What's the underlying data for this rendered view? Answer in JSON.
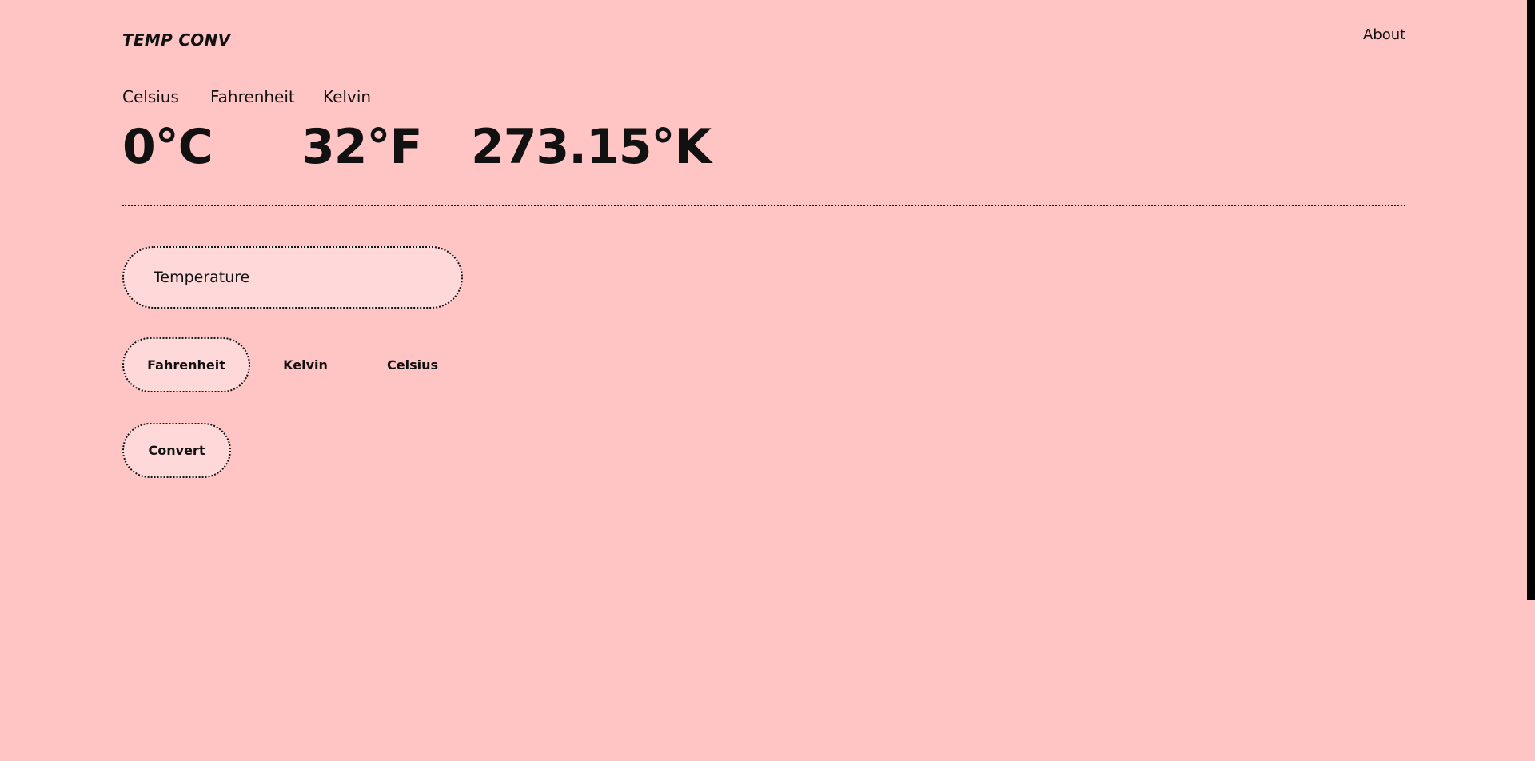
{
  "header": {
    "brand": "TEMP CONV",
    "about_label": "About"
  },
  "units": {
    "labels": [
      "Celsius",
      "Fahrenheit",
      "Kelvin"
    ]
  },
  "readouts": {
    "celsius": "0°C",
    "fahrenheit": "32°F",
    "kelvin": "273.15°K"
  },
  "form": {
    "temperature_placeholder": "Temperature",
    "temperature_value": "",
    "options": [
      "Fahrenheit",
      "Kelvin",
      "Celsius"
    ],
    "selected_option": "Fahrenheit",
    "convert_label": "Convert"
  },
  "colors": {
    "background": "#ffc5c5",
    "field_fill": "#ffd9d9",
    "text": "#111111"
  }
}
